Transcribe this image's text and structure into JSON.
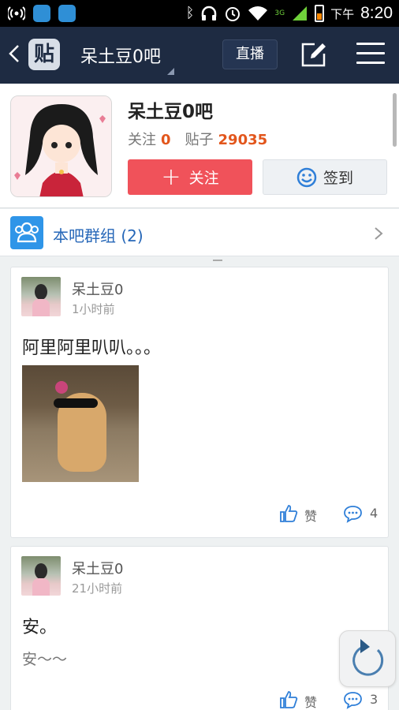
{
  "status_bar": {
    "ampm": "下午",
    "time": "8:20",
    "network": "3G",
    "icons": [
      "wifi-hotspot-icon",
      "app-icon",
      "app-icon",
      "bluetooth-icon",
      "headphones-icon",
      "alarm-icon",
      "wifi-icon",
      "signal-icon",
      "battery-icon"
    ]
  },
  "header": {
    "title": "呆土豆0吧",
    "logo_text": "贴",
    "live_label": "直播",
    "colors": {
      "bar": "#1e2b42"
    }
  },
  "profile": {
    "name": "呆土豆0吧",
    "follow_stat_label": "关注",
    "follow_stat_value": "0",
    "posts_stat_label": "贴子",
    "posts_stat_value": "29035",
    "follow_button": "关注",
    "sign_button": "签到",
    "colors": {
      "follow": "#f0525a",
      "stat_value": "#e2561c"
    }
  },
  "group": {
    "label": "本吧群组 (2)"
  },
  "posts": [
    {
      "user": "呆土豆0",
      "time": "1小时前",
      "title": "阿里阿里叭叭。。。",
      "like_label": "赞",
      "comment_count": "4"
    },
    {
      "user": "呆土豆0",
      "time": "21小时前",
      "title": "安。",
      "body": "安～～",
      "like_label": "赞",
      "comment_count": "3"
    }
  ]
}
